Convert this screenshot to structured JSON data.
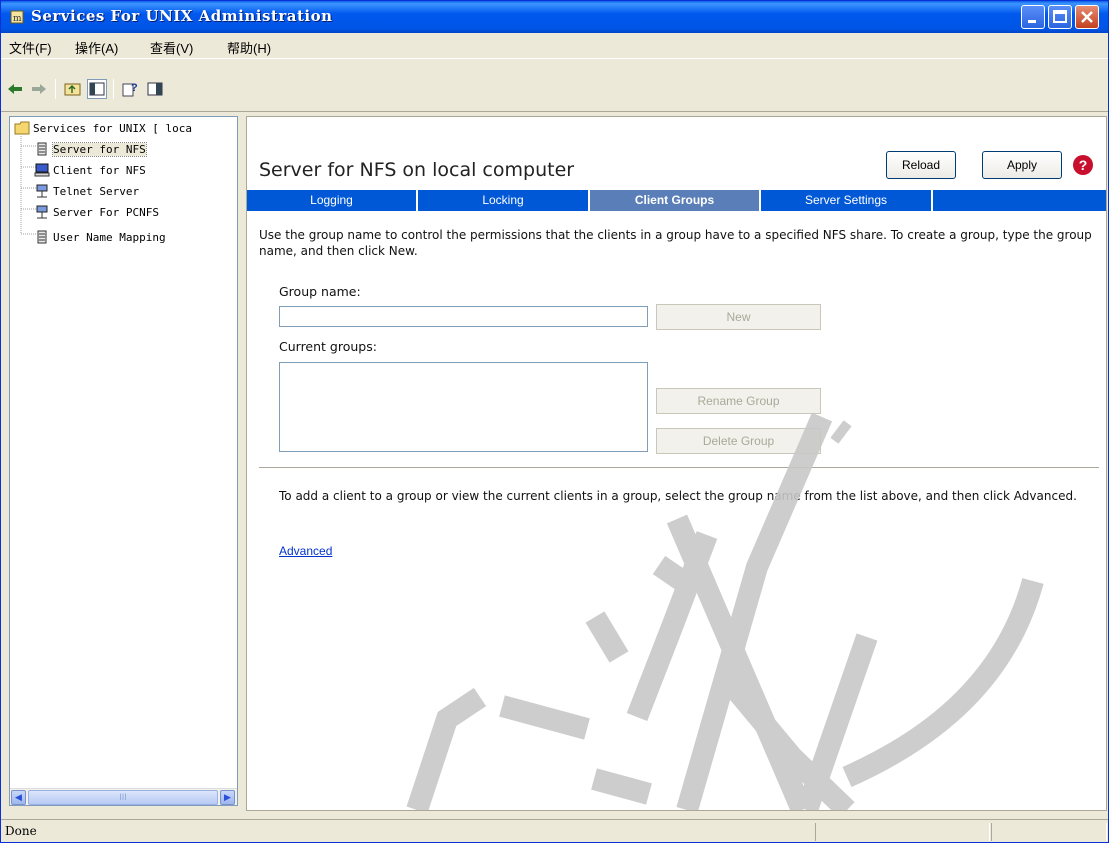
{
  "window": {
    "title": "Services For UNIX Administration"
  },
  "menu": [
    "文件(F)",
    "操作(A)",
    "查看(V)",
    "帮助(H)"
  ],
  "toolbar": {
    "icons": [
      "back-arrow-icon",
      "forward-arrow-icon",
      "up-folder-icon",
      "show-tree-icon",
      "help-icon",
      "console-icon"
    ]
  },
  "tree": {
    "root": "Services for UNIX [ loca",
    "items": [
      "Server for NFS",
      "Client for NFS",
      "Telnet Server",
      "Server For PCNFS",
      "User Name Mapping"
    ],
    "selected": "Server for NFS",
    "scroll_thumb": "III"
  },
  "panel": {
    "title": "Server for NFS on local computer",
    "reload": "Reload",
    "apply": "Apply",
    "help": "?",
    "tabs": [
      "Logging",
      "Locking",
      "Client Groups",
      "Server Settings"
    ],
    "active_tab": "Client Groups",
    "description": "Use the group name to control the permissions that the clients in a group have to a specified NFS share. To create a group, type the group name, and then click New.",
    "group_name_label": "Group name:",
    "group_name_value": "",
    "new_button": "New",
    "current_groups_label": "Current groups:",
    "rename_button": "Rename Group",
    "delete_button": "Delete Group",
    "advanced_description": "To add a client to a group or view the current clients in a group, select the group name from the list above, and then click Advanced.",
    "advanced_link": "Advanced"
  },
  "status": {
    "text": "Done"
  },
  "colors": {
    "titlebar": "#0058EE",
    "tabbar": "#0058D6",
    "active_tab": "#5A7FB8",
    "link": "#0033CC"
  }
}
